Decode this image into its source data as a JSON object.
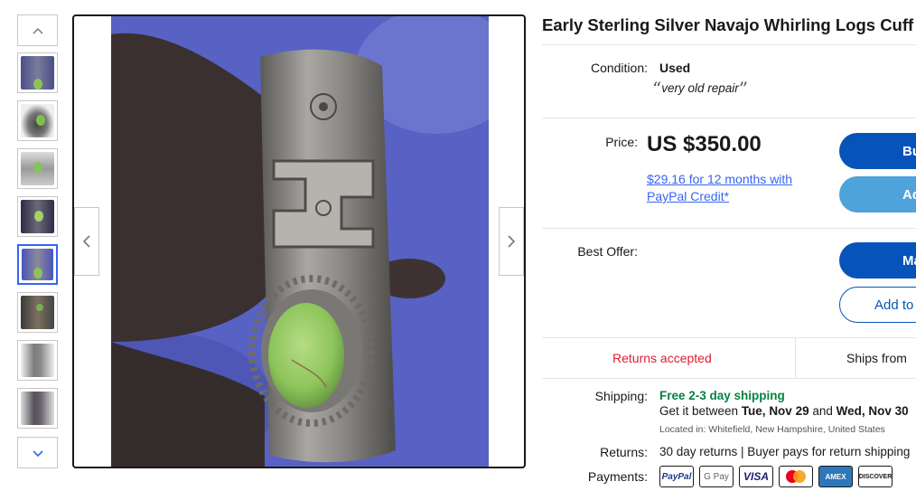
{
  "item": {
    "title": "Early Sterling Silver Navajo Whirling Logs Cuff"
  },
  "condition": {
    "label": "Condition:",
    "value": "Used",
    "note": "very old repair",
    "quote_open": "“",
    "quote_close": "”"
  },
  "price": {
    "label": "Price:",
    "value": "US $350.00",
    "credit_line": "$29.16 for 12 months with PayPal Credit*"
  },
  "buttons": {
    "buy_now": "Buy It Now",
    "add_to_cart": "Add to cart",
    "make_offer": "Make offer",
    "add_to_watchlist": "Add to watchlist"
  },
  "best_offer": {
    "label": "Best Offer:"
  },
  "badges": {
    "returns": "Returns accepted",
    "ships_from": "Ships from"
  },
  "shipping": {
    "label": "Shipping:",
    "free": "Free 2-3 day shipping",
    "between_prefix": "Get it between ",
    "date_start": "Tue, Nov 29",
    "and": " and ",
    "date_end": "Wed, Nov 30",
    "location": "Located in: Whitefield, New Hampshire, United States"
  },
  "returns": {
    "label": "Returns:",
    "value": "30 day returns | Buyer pays for return shipping"
  },
  "payments": {
    "label": "Payments:",
    "methods": [
      "PayPal",
      "G Pay",
      "VISA",
      "mastercard",
      "AMEX",
      "DISCOVER"
    ]
  },
  "gallery": {
    "thumbnail_count": 8,
    "selected_index": 4,
    "icons": {
      "up": "chevron-up-icon",
      "down": "chevron-down-icon",
      "prev": "chevron-left-icon",
      "next": "chevron-right-icon"
    }
  },
  "colors": {
    "accent": "#3665f3",
    "primary_button": "#0654ba",
    "secondary_button": "#4ea3db",
    "returns_red": "#dd1e31",
    "free_shipping_green": "#05823f"
  }
}
